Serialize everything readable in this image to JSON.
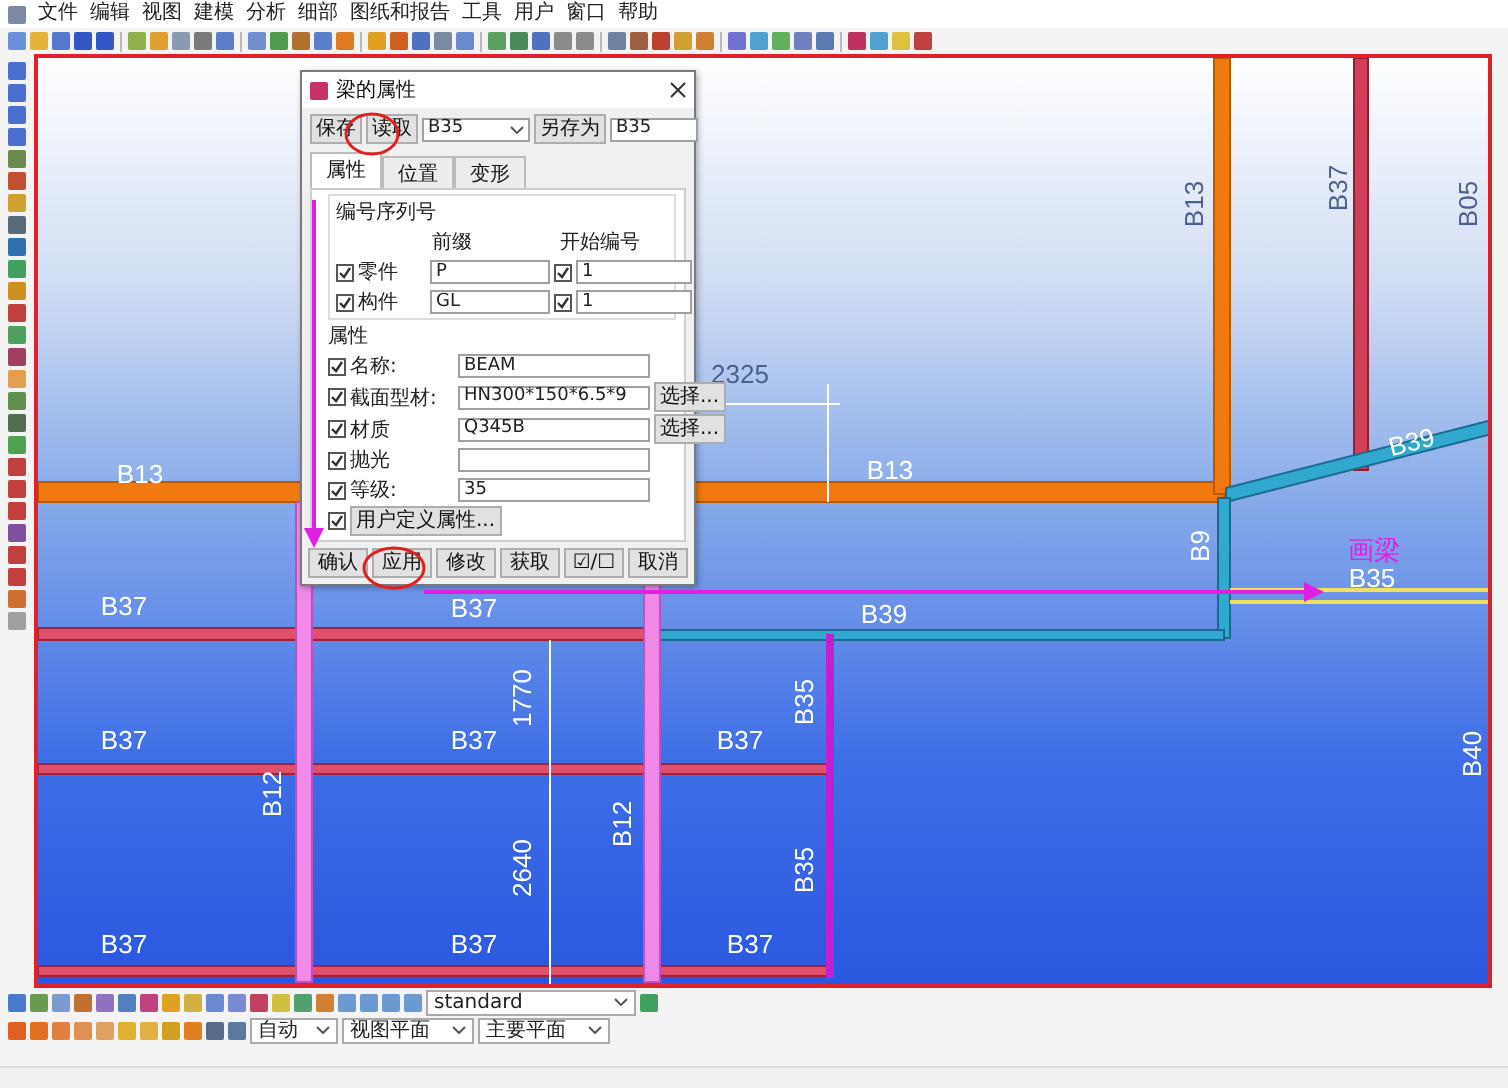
{
  "menu": [
    "文件",
    "编辑",
    "视图",
    "建模",
    "分析",
    "细部",
    "图纸和报告",
    "工具",
    "用户",
    "窗口",
    "帮助"
  ],
  "dialog": {
    "title": "梁的属性",
    "save": "保存",
    "load": "读取",
    "preset": "B35",
    "save_as": "另存为",
    "save_as_name": "B35",
    "tabs": [
      {
        "label": "属性",
        "selected": true
      },
      {
        "label": "位置",
        "selected": false
      },
      {
        "label": "变形",
        "selected": false
      }
    ],
    "numbering": {
      "title": "编号序列号",
      "prefix_header": "前缀",
      "start_header": "开始编号",
      "rows": [
        {
          "label": "零件",
          "checked": true,
          "prefix": "P",
          "start_checked": true,
          "start": "1"
        },
        {
          "label": "构件",
          "checked": true,
          "prefix": "GL",
          "start_checked": true,
          "start": "1"
        }
      ]
    },
    "attributes": {
      "title": "属性",
      "fields": [
        {
          "label": "名称:",
          "checked": true,
          "value": "BEAM"
        },
        {
          "label": "截面型材:",
          "checked": true,
          "value": "HN300*150*6.5*9",
          "button": "选择..."
        },
        {
          "label": "材质",
          "checked": true,
          "value": "Q345B",
          "button": "选择..."
        },
        {
          "label": "抛光",
          "checked": true
        },
        {
          "label": "等级:",
          "checked": true,
          "value": "35"
        }
      ],
      "user_defined": {
        "checked": true,
        "label": "用户定义属性..."
      }
    },
    "actions": [
      "确认",
      "应用",
      "修改",
      "获取",
      "☑/☐",
      "取消"
    ]
  },
  "viewport": {
    "note": "画梁",
    "labels": [
      "B13",
      "2325",
      "B13",
      "B13",
      "B37",
      "B05",
      "B39",
      "B9",
      "B35",
      "B37",
      "B37",
      "B39",
      "B35",
      "1770",
      "B37",
      "B37",
      "B37",
      "B40",
      "B12",
      "B12",
      "2640",
      "B35",
      "B37",
      "B37",
      "B37"
    ]
  },
  "bottom_toolbar": {
    "filter": "standard",
    "selects": [
      "自动",
      "视图平面",
      "主要平面"
    ]
  }
}
